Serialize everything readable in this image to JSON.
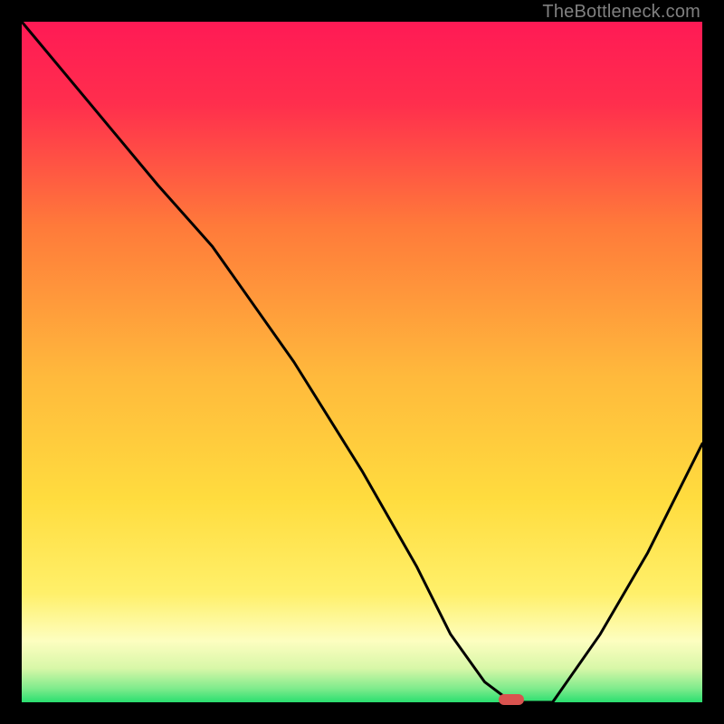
{
  "watermark": "TheBottleneck.com",
  "colors": {
    "gradient_top": "#ff1a4d",
    "gradient_mid1": "#ff6a3a",
    "gradient_mid2": "#ffd23e",
    "gradient_mid3": "#fff56a",
    "gradient_bottom": "#2adf6f",
    "curve": "#000000",
    "marker": "#d9534f",
    "frame_bg": "#ffffff",
    "page_bg": "#000000"
  },
  "chart_data": {
    "type": "line",
    "title": "",
    "xlabel": "",
    "ylabel": "",
    "xlim": [
      0,
      100
    ],
    "ylim": [
      0,
      100
    ],
    "series": [
      {
        "name": "bottleneck-curve",
        "x": [
          0,
          10,
          20,
          28,
          40,
          50,
          58,
          63,
          68,
          72,
          78,
          85,
          92,
          100
        ],
        "values": [
          100,
          88,
          76,
          67,
          50,
          34,
          20,
          10,
          3,
          0,
          0,
          10,
          22,
          38
        ]
      }
    ],
    "marker": {
      "x": 72,
      "y": 0
    },
    "annotations": []
  }
}
